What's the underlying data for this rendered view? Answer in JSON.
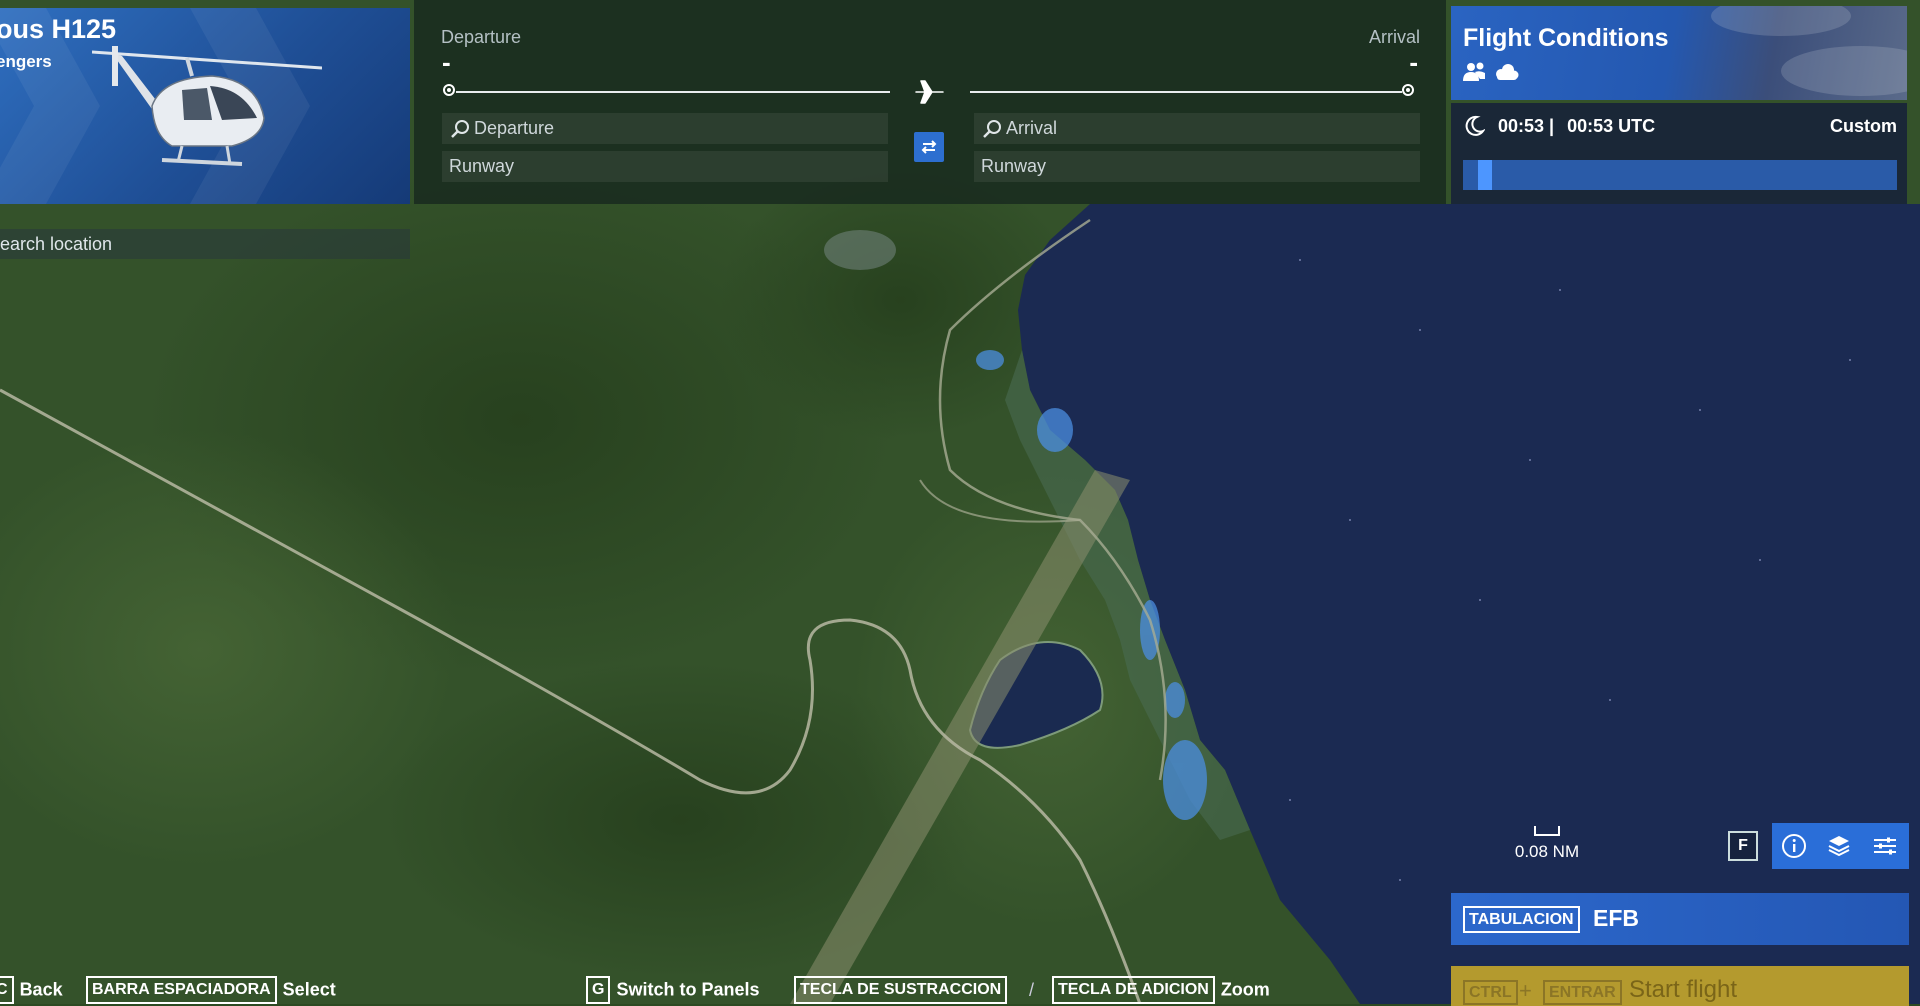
{
  "aircraft": {
    "name": "ous H125",
    "subtitle": "engers"
  },
  "search": {
    "placeholder": "earch location"
  },
  "route": {
    "departure_label": "Departure",
    "departure_value": "-",
    "arrival_label": "Arrival",
    "arrival_value": "-",
    "departure_search_placeholder": "Departure",
    "arrival_search_placeholder": "Arrival",
    "departure_runway_placeholder": "Runway",
    "arrival_runway_placeholder": "Runway"
  },
  "conditions": {
    "title": "Flight Conditions",
    "local_time": "00:53 |",
    "utc_time": "00:53 UTC",
    "mode": "Custom",
    "time_of_day_fraction": 0.035
  },
  "map": {
    "scale_label": "0.08 NM",
    "f_key": "F"
  },
  "efb": {
    "key": "TABULACION",
    "label": "EFB"
  },
  "start": {
    "key1": "CTRL",
    "plus": "+",
    "key2": "ENTRAR",
    "label": "Start flight"
  },
  "hints": {
    "back_key": "C",
    "back_label": "Back",
    "select_key": "BARRA ESPACIADORA",
    "select_label": "Select",
    "panels_key": "G",
    "panels_label": "Switch to Panels",
    "zoom_out_key": "TECLA DE SUSTRACCION",
    "separator": "/",
    "zoom_in_key": "TECLA DE ADICION",
    "zoom_label": "Zoom"
  },
  "colors": {
    "accent": "#2d6fd0",
    "start_button": "#b49a2e",
    "water": "#1b2a52",
    "forest": "#2e4c24"
  }
}
